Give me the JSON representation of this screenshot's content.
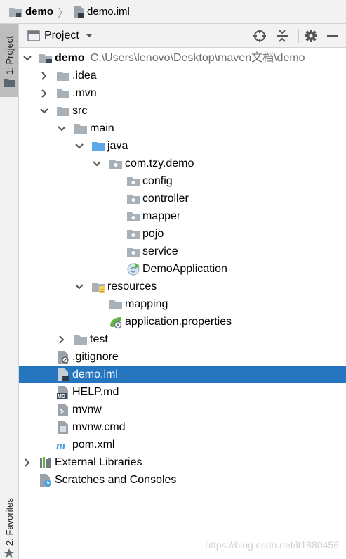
{
  "breadcrumb": {
    "project": "demo",
    "file": "demo.iml"
  },
  "left_stripe": {
    "project_tab": "1: Project",
    "favorites_tab": "2: Favorites"
  },
  "panel": {
    "title": "Project"
  },
  "tree": {
    "root_name": "demo",
    "root_path": "C:\\Users\\lenovo\\Desktop\\maven文档\\demo",
    "idea": ".idea",
    "mvn": ".mvn",
    "src": "src",
    "main": "main",
    "java": "java",
    "package": "com.tzy.demo",
    "config": "config",
    "controller": "controller",
    "mapper": "mapper",
    "pojo": "pojo",
    "service": "service",
    "app_class": "DemoApplication",
    "resources": "resources",
    "mapping": "mapping",
    "app_props": "application.properties",
    "test": "test",
    "gitignore": ".gitignore",
    "demo_iml": "demo.iml",
    "help_md": "HELP.md",
    "mvnw": "mvnw",
    "mvnw_cmd": "mvnw.cmd",
    "pom": "pom.xml",
    "ext_libs": "External Libraries",
    "scratches": "Scratches and Consoles"
  },
  "selected_item": "demo.iml",
  "watermark": "https://blog.csdn.net/lt1880456",
  "colors": {
    "selection": "#2675bf",
    "folder": "#a9b1b8",
    "source_folder": "#5ea7e8",
    "accent_green": "#62b543"
  }
}
